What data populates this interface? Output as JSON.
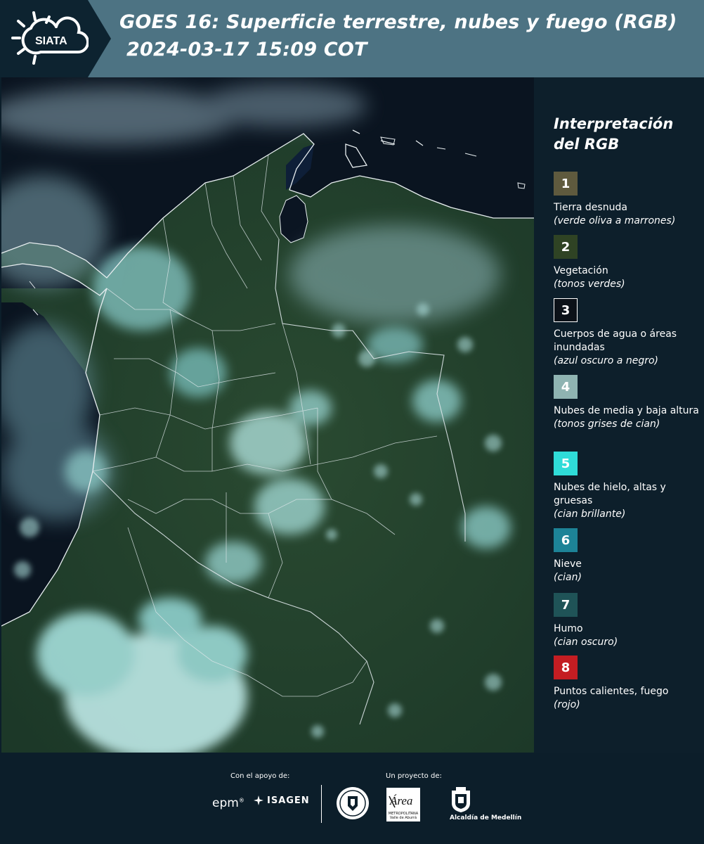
{
  "header": {
    "title_line1": "GOES 16: Superficie terrestre, nubes y fuego (RGB)",
    "title_line2": "2024-03-17 15:09 COT",
    "logo_text": "SIATA"
  },
  "legend": {
    "title": "Interpretación del RGB",
    "items": [
      {
        "number": "1",
        "label": "Tierra desnuda",
        "desc": "(verde oliva a marrones)",
        "color": "#5f5a3e"
      },
      {
        "number": "2",
        "label": "Vegetación",
        "desc": "(tonos verdes)",
        "color": "#2f4324"
      },
      {
        "number": "3",
        "label": "Cuerpos de agua o áreas inundadas",
        "desc": "(azul oscuro a negro)",
        "color": "#0b1118"
      },
      {
        "number": "4",
        "label": "Nubes de media y baja altura",
        "desc": "(tonos grises de cian)",
        "color": "#8fb4b2"
      },
      {
        "number": "5",
        "label": "Nubes de hielo, altas y gruesas",
        "desc": "(cian brillante)",
        "color": "#2fdcd8"
      },
      {
        "number": "6",
        "label": "Nieve",
        "desc": "(cian)",
        "color": "#1d8397"
      },
      {
        "number": "7",
        "label": "Humo",
        "desc": "(cian oscuro)",
        "color": "#1f5357"
      },
      {
        "number": "8",
        "label": "Puntos calientes, fuego",
        "desc": "(rojo)",
        "color": "#c41d22"
      }
    ]
  },
  "footer": {
    "support_label": "Con el apoyo de:",
    "project_label": "Un proyecto de:",
    "epm": "epm",
    "isagen": "ISAGEN",
    "area_logo_text": "Área",
    "area_sub": "METROPOLITANA Valle de Aburrá",
    "alcaldia": "Alcaldía de Medellín"
  },
  "colors": {
    "header_bg": "#4d7383",
    "header_dark": "#0d2330",
    "legend_bg": "#0d1f2b",
    "ocean": "#0a1420",
    "land": "#23402e",
    "cloud": "#8fd0d0",
    "border": "#e8eef0"
  }
}
